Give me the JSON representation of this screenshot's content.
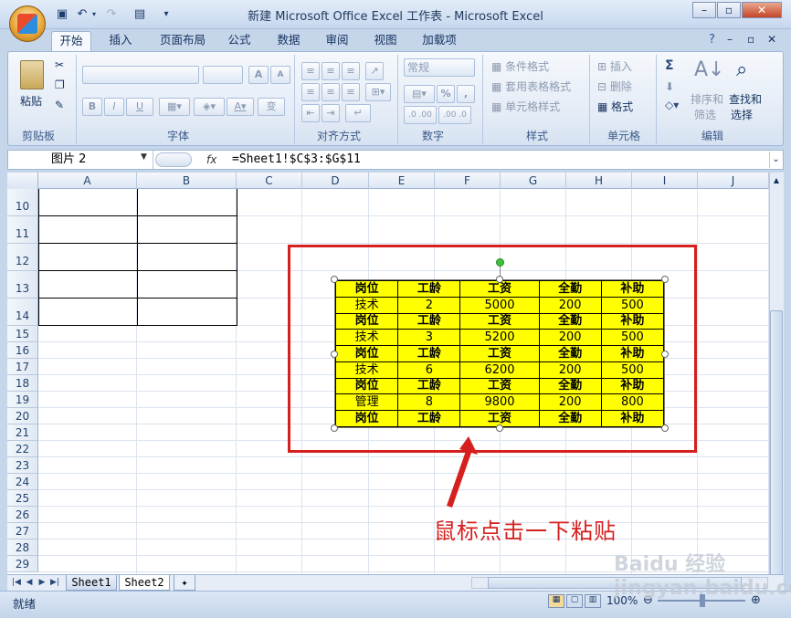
{
  "title_bar": {
    "title": "新建 Microsoft Office Excel 工作表 - Microsoft Excel",
    "window_buttons": [
      "minimize-icon",
      "restore-icon",
      "close-icon"
    ]
  },
  "quick_access": [
    "save-icon",
    "undo-icon",
    "redo-icon",
    "print-preview-icon",
    "customize-icon"
  ],
  "ribbon_tabs": [
    {
      "label": "开始",
      "selected": true
    },
    {
      "label": "插入"
    },
    {
      "label": "页面布局"
    },
    {
      "label": "公式"
    },
    {
      "label": "数据"
    },
    {
      "label": "审阅"
    },
    {
      "label": "视图"
    },
    {
      "label": "加载项"
    }
  ],
  "ribbon": {
    "clipboard": {
      "paste": "粘贴",
      "group": "剪贴板"
    },
    "font": {
      "group": "字体",
      "bold": "B",
      "italic": "I",
      "underline": "U",
      "grow": "A",
      "shrink": "A",
      "wen": "变"
    },
    "alignment": {
      "group": "对齐方式"
    },
    "number": {
      "group": "数字",
      "format": "常规",
      "percent": "%",
      "comma": ",",
      "inc_dec": ".0 .00",
      "dec_dec": ".00 .0"
    },
    "styles": {
      "group": "样式",
      "conditional": "条件格式",
      "table": "套用表格格式",
      "cell_styles": "单元格样式"
    },
    "cells": {
      "group": "单元格",
      "insert": "插入",
      "delete": "删除",
      "format": "格式"
    },
    "editing": {
      "group": "编辑",
      "sum": "Σ",
      "sort": "排序和",
      "sort2": "筛选",
      "find": "查找和",
      "find2": "选择"
    }
  },
  "formula_bar": {
    "name_box": "图片 2",
    "fx": "fx",
    "formula": "=Sheet1!$C$3:$G$11"
  },
  "columns": [
    "A",
    "B",
    "C",
    "D",
    "E",
    "F",
    "G",
    "H",
    "I",
    "J"
  ],
  "rows": [
    "10",
    "11",
    "12",
    "13",
    "14",
    "15",
    "16",
    "17",
    "18",
    "19",
    "20",
    "21",
    "22",
    "23",
    "24",
    "25",
    "26",
    "27",
    "28",
    "29"
  ],
  "picture_table": {
    "rows": [
      {
        "hdr": true,
        "cells": [
          "岗位",
          "工龄",
          "工资",
          "全勤",
          "补助"
        ]
      },
      {
        "hdr": false,
        "cells": [
          "技术",
          "2",
          "5000",
          "200",
          "500"
        ]
      },
      {
        "hdr": true,
        "cells": [
          "岗位",
          "工龄",
          "工资",
          "全勤",
          "补助"
        ]
      },
      {
        "hdr": false,
        "cells": [
          "技术",
          "3",
          "5200",
          "200",
          "500"
        ]
      },
      {
        "hdr": true,
        "cells": [
          "岗位",
          "工龄",
          "工资",
          "全勤",
          "补助"
        ]
      },
      {
        "hdr": false,
        "cells": [
          "技术",
          "6",
          "6200",
          "200",
          "500"
        ]
      },
      {
        "hdr": true,
        "cells": [
          "岗位",
          "工龄",
          "工资",
          "全勤",
          "补助"
        ]
      },
      {
        "hdr": false,
        "cells": [
          "管理",
          "8",
          "9800",
          "200",
          "800"
        ]
      },
      {
        "hdr": true,
        "cells": [
          "岗位",
          "工龄",
          "工资",
          "全勤",
          "补助"
        ]
      }
    ],
    "fill_color": "#ffff00"
  },
  "annotation": {
    "text": "鼠标点击一下粘贴",
    "color": "#d62020"
  },
  "sheet_tabs": [
    "Sheet1",
    "Sheet2"
  ],
  "status_bar": {
    "status": "就绪",
    "zoom": "100%"
  },
  "watermark": "Baidu 经验 jingyan.baidu.com"
}
